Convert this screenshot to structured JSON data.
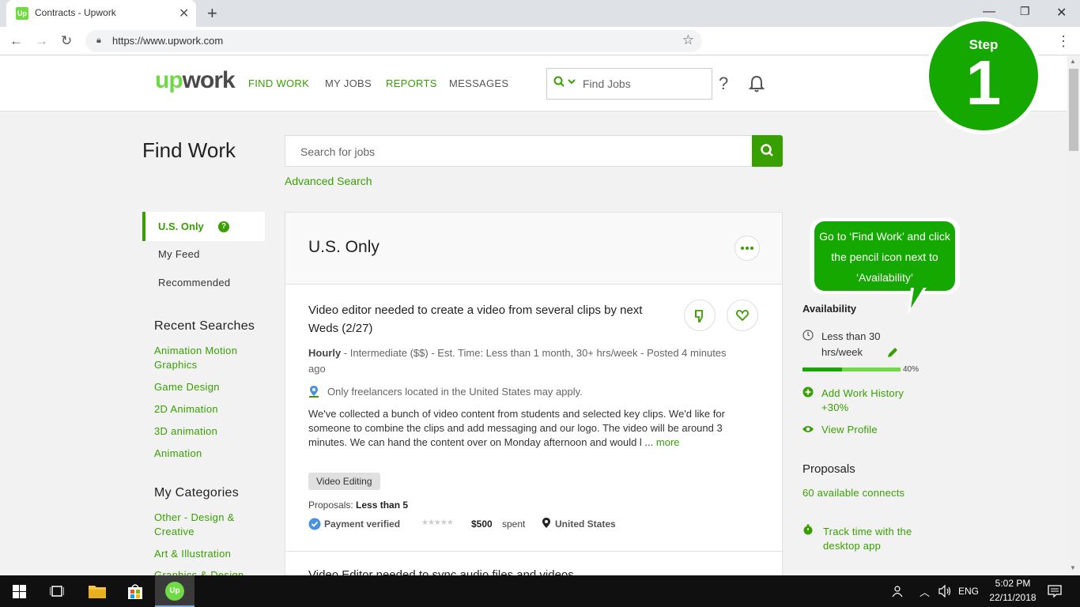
{
  "browser": {
    "tab_title": "Contracts - Upwork",
    "favicon_text": "Up",
    "url": "https://www.upwork.com"
  },
  "header": {
    "logo_up": "up",
    "logo_rest": "work",
    "nav": [
      "FIND WORK",
      "MY JOBS",
      "REPORTS",
      "MESSAGES"
    ],
    "search_placeholder": "Find Jobs"
  },
  "step_badge": {
    "label": "Step",
    "number": "1"
  },
  "main": {
    "title": "Find Work",
    "search_placeholder": "Search for jobs",
    "advanced_search": "Advanced Search"
  },
  "left": {
    "active": "U.S. Only",
    "items": [
      "My Feed",
      "Recommended"
    ],
    "recent_title": "Recent Searches",
    "recent": [
      "Animation Motion Graphics",
      "Game Design",
      "2D Animation",
      "3D animation",
      "Animation"
    ],
    "categories_title": "My Categories",
    "categories": [
      "Other - Design & Creative",
      "Art & Illustration",
      "Graphics & Design"
    ]
  },
  "feed": {
    "title": "U.S. Only",
    "job": {
      "title": "Video editor needed to create a video from several clips by next Weds (2/27)",
      "type": "Hourly",
      "meta": " - Intermediate ($$) - Est. Time: Less than 1 month, 30+ hrs/week - Posted 4 minutes ago",
      "note": "Only freelancers located in the United States may apply.",
      "description": "We've collected a bunch of video content from students and selected key clips. We'd like for someone to combine the clips and add messaging and our logo. The video will be around 3 minutes. We can hand the content over on Monday afternoon and would l ...",
      "more": "more",
      "tag": "Video Editing",
      "proposals_label": "Proposals:",
      "proposals_value": "Less than 5",
      "payment": "Payment verified",
      "spent_amount": "$500",
      "spent_label": "spent",
      "country": "United States"
    },
    "next_title": "Video Editor needed to sync audio files and videos"
  },
  "right": {
    "callout": "Go to ‘Find Work’ and click the pencil icon next to ‘Availability’",
    "availability_title": "Availability",
    "availability": "Less than 30 hrs/week",
    "progress_percent": 40,
    "progress_label": "40%",
    "add_work": "Add Work History +30%",
    "view_profile": "View Profile",
    "proposals_title": "Proposals",
    "connects": "60 available connects",
    "track": "Track time with the desktop app"
  },
  "taskbar": {
    "lang": "ENG",
    "time": "5:02 PM",
    "date": "22/11/2018"
  },
  "colors": {
    "brand_green": "#37a000",
    "logo_green": "#6fda44",
    "step_green": "#14a800"
  }
}
